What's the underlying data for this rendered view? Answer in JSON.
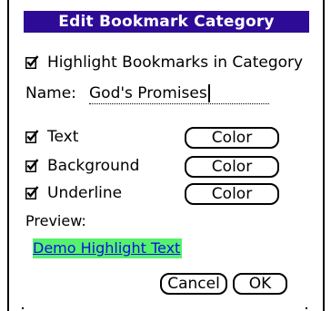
{
  "dialog": {
    "title": "Edit Bookmark Category",
    "highlight_checkbox": {
      "label": "Highlight Bookmarks in Category",
      "checked": true
    },
    "name": {
      "label": "Name:",
      "value": "God's Promises"
    },
    "options": [
      {
        "label": "Text",
        "checked": true,
        "button_label": "Color"
      },
      {
        "label": "Background",
        "checked": true,
        "button_label": "Color"
      },
      {
        "label": "Underline",
        "checked": true,
        "button_label": "Color"
      }
    ],
    "preview": {
      "label": "Preview:",
      "sample_text": "Demo Highlight Text"
    },
    "buttons": {
      "cancel_label": "Cancel",
      "ok_label": "OK"
    }
  },
  "colors": {
    "title_bar": "#2e0b96",
    "title_text": "#ffffff",
    "preview_background": "#55f26e",
    "preview_text": "#1010e0"
  },
  "icons": {
    "checkbox_checked": "checkbox-checked-icon"
  }
}
